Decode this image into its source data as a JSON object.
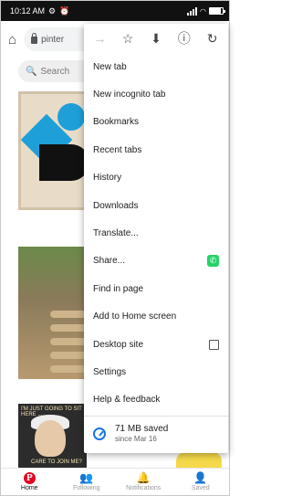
{
  "status_bar": {
    "time": "10:12 AM",
    "battery_fraction": 0.85
  },
  "browser": {
    "url": "pinter",
    "home_icon": "home-icon"
  },
  "page": {
    "search_placeholder": "Search",
    "pin3_text": "I'M JUST GOING TO SIT HERE ...",
    "pin3_caption": "CARE TO JOIN ME?"
  },
  "bottom_nav": [
    {
      "label": "Home",
      "icon": "pinterest-logo",
      "active": true
    },
    {
      "label": "Following",
      "icon": "people-icon"
    },
    {
      "label": "Notifications",
      "icon": "bell-icon"
    },
    {
      "label": "Saved",
      "icon": "person-icon"
    }
  ],
  "menu": {
    "icon_row": [
      "forward-icon",
      "star-icon",
      "download-icon",
      "info-icon",
      "refresh-icon"
    ],
    "items": [
      {
        "label": "New tab"
      },
      {
        "label": "New incognito tab"
      },
      {
        "label": "Bookmarks"
      },
      {
        "label": "Recent tabs"
      },
      {
        "label": "History"
      },
      {
        "label": "Downloads"
      },
      {
        "label": "Translate..."
      },
      {
        "label": "Share...",
        "trailing": "whatsapp-icon"
      },
      {
        "label": "Find in page"
      },
      {
        "label": "Add to Home screen"
      },
      {
        "label": "Desktop site",
        "trailing": "checkbox"
      },
      {
        "label": "Settings"
      },
      {
        "label": "Help & feedback"
      }
    ],
    "data_saved": {
      "amount": "71 MB saved",
      "since": "since Mar 16"
    }
  },
  "colors": {
    "pinterest_red": "#e60023",
    "chrome_blue": "#1a73e8",
    "whatsapp_green": "#25d366"
  }
}
